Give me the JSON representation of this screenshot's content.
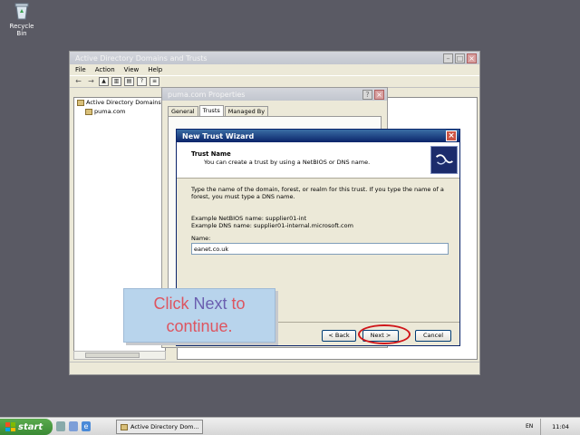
{
  "desktop": {
    "recycle_bin_label": "Recycle Bin"
  },
  "ad_window": {
    "title": "Active Directory Domains and Trusts",
    "menu": [
      "File",
      "Action",
      "View",
      "Help"
    ],
    "tree": {
      "root": "Active Directory Domains an",
      "child": "puma.com"
    }
  },
  "props_window": {
    "title": "puma.com Properties",
    "tabs": [
      "General",
      "Trusts",
      "Managed By"
    ],
    "active_tab": "Trusts"
  },
  "wizard": {
    "title": "New Trust Wizard",
    "header_title": "Trust Name",
    "header_subtitle": "You can create a trust by using a NetBIOS or DNS name.",
    "description": "Type the name of the domain, forest, or realm for this trust. If you type the name of a forest, you must type a DNS name.",
    "example_netbios": "Example NetBIOS name: supplier01-int",
    "example_dns": "Example DNS name: supplier01-internal.microsoft.com",
    "name_label": "Name:",
    "name_value": "eanet.co.uk",
    "back_label": "< Back",
    "next_label": "Next >",
    "cancel_label": "Cancel"
  },
  "callout": {
    "line1_a": "Click ",
    "line1_b": "Next",
    "line1_c": " to",
    "line2": "continue."
  },
  "taskbar": {
    "start_label": "start",
    "task_label": "Active Directory Dom...",
    "language": "EN",
    "clock": "11:04"
  },
  "colors": {
    "callout_text": "#dd5560",
    "callout_highlight": "#6b5fb0",
    "highlight_ring": "#d0161a"
  }
}
